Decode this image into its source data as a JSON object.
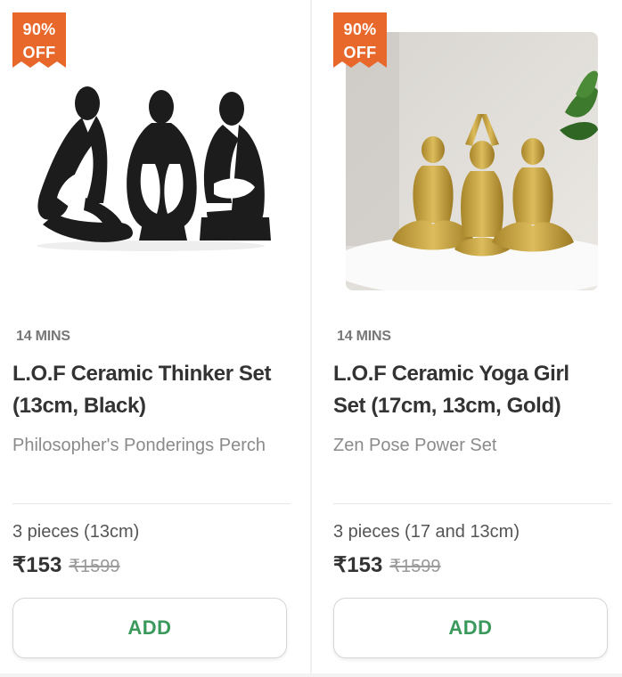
{
  "products": [
    {
      "discount_line1": "90%",
      "discount_line2": "OFF",
      "delivery_time": "14 MINS",
      "name": "L.O.F Ceramic Thinker Set (13cm, Black)",
      "subtitle": "Philosopher's Ponderings Perch",
      "quantity": "3 pieces (13cm)",
      "price": "₹153",
      "mrp": "₹1599",
      "add_label": "ADD",
      "image_icon": "black-thinker-statues-image"
    },
    {
      "discount_line1": "90%",
      "discount_line2": "OFF",
      "delivery_time": "14 MINS",
      "name": "L.O.F Ceramic Yoga Girl Set (17cm, 13cm, Gold)",
      "subtitle": "Zen Pose Power Set",
      "quantity": "3 pieces (17 and 13cm)",
      "price": "₹153",
      "mrp": "₹1599",
      "add_label": "ADD",
      "image_icon": "gold-yoga-statues-image"
    }
  ],
  "colors": {
    "badge": "#e8672a",
    "add_button_text": "#3a9a5c",
    "title_text": "#333333"
  }
}
